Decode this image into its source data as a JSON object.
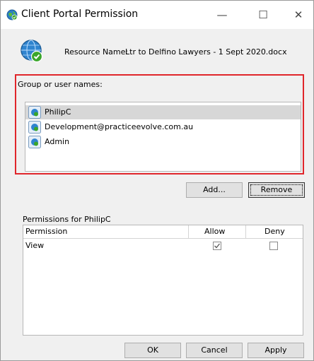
{
  "window": {
    "title": "Client Portal Permission",
    "controls": {
      "minimize": "—",
      "maximize": "☐",
      "close": "✕"
    }
  },
  "resource": {
    "label": "Resource Name:",
    "value": "Ltr to Delfino Lawyers - 1 Sept 2020.docx",
    "icon": "globe-check-icon"
  },
  "groups": {
    "label": "Group or user names:",
    "users": [
      {
        "name": "PhilipC",
        "selected": true
      },
      {
        "name": "Development@practiceevolve.com.au",
        "selected": false
      },
      {
        "name": "Admin",
        "selected": false
      }
    ],
    "add_label": "Add...",
    "remove_label": "Remove"
  },
  "permissions": {
    "label": "Permissions for PhilipC",
    "columns": [
      "Permission",
      "Allow",
      "Deny"
    ],
    "rows": [
      {
        "name": "View",
        "allow": true,
        "deny": false
      }
    ]
  },
  "footer": {
    "ok_label": "OK",
    "cancel_label": "Cancel",
    "apply_label": "Apply"
  },
  "colors": {
    "highlight_border": "#e0262b",
    "selected_row": "#d7d7d7"
  }
}
